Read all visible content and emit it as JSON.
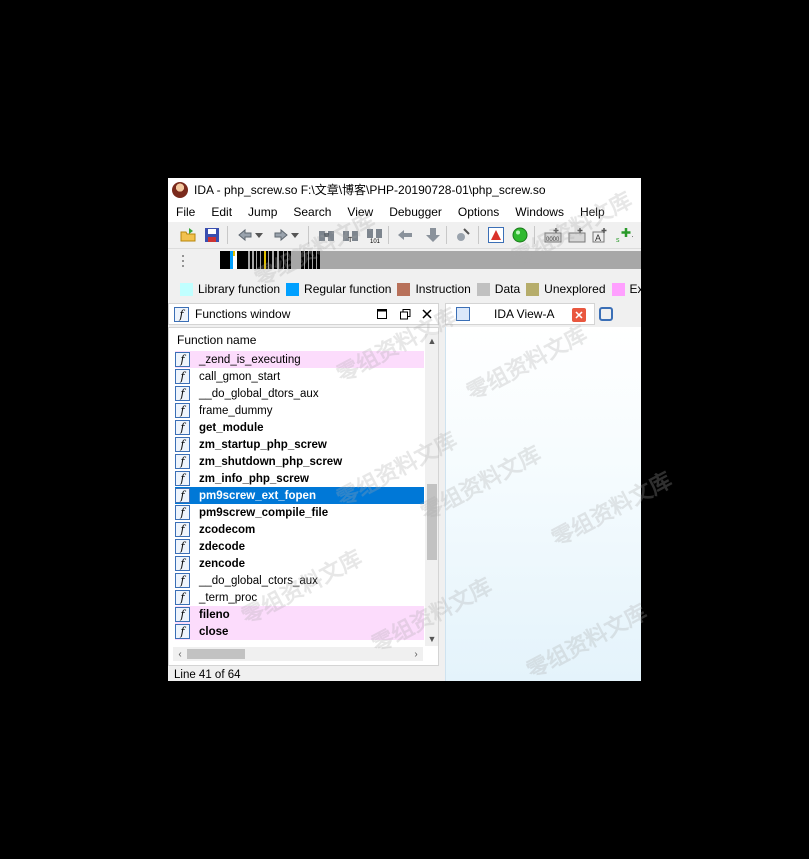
{
  "window": {
    "title": "IDA - php_screw.so F:\\文章\\博客\\PHP-20190728-01\\php_screw.so",
    "app_icon": "ida-icon"
  },
  "menu": [
    "File",
    "Edit",
    "Jump",
    "Search",
    "View",
    "Debugger",
    "Options",
    "Windows",
    "Help"
  ],
  "toolbar": {
    "icons": [
      "open-icon",
      "save-icon",
      "back-icon",
      "forward-icon",
      "binoculars-icon",
      "binoculars-text-icon",
      "binoculars-hex-icon",
      "jump-icon",
      "down-arrow-icon",
      "debug-icon",
      "warning-icon",
      "run-icon",
      "add-code-icon",
      "add-data-icon",
      "add-string-icon",
      "add-struct-icon"
    ]
  },
  "legend": [
    {
      "label": "Library function",
      "color": "#c0ffff"
    },
    {
      "label": "Regular function",
      "color": "#00a0ff"
    },
    {
      "label": "Instruction",
      "color": "#b8715a"
    },
    {
      "label": "Data",
      "color": "#c0c0c0"
    },
    {
      "label": "Unexplored",
      "color": "#b6ad6b"
    },
    {
      "label": "External symbol",
      "color": "#ffa0ff"
    }
  ],
  "functions_window": {
    "title": "Functions window",
    "column_header": "Function name",
    "rows": [
      {
        "name": "_zend_is_executing",
        "bold": false,
        "pink": true,
        "selected": false
      },
      {
        "name": "call_gmon_start",
        "bold": false,
        "pink": false,
        "selected": false
      },
      {
        "name": "__do_global_dtors_aux",
        "bold": false,
        "pink": false,
        "selected": false
      },
      {
        "name": "frame_dummy",
        "bold": false,
        "pink": false,
        "selected": false
      },
      {
        "name": "get_module",
        "bold": true,
        "pink": false,
        "selected": false
      },
      {
        "name": "zm_startup_php_screw",
        "bold": true,
        "pink": false,
        "selected": false
      },
      {
        "name": "zm_shutdown_php_screw",
        "bold": true,
        "pink": false,
        "selected": false
      },
      {
        "name": "zm_info_php_screw",
        "bold": true,
        "pink": false,
        "selected": false
      },
      {
        "name": "pm9screw_ext_fopen",
        "bold": true,
        "pink": false,
        "selected": true
      },
      {
        "name": "pm9screw_compile_file",
        "bold": true,
        "pink": false,
        "selected": false
      },
      {
        "name": "zcodecom",
        "bold": true,
        "pink": false,
        "selected": false
      },
      {
        "name": "zdecode",
        "bold": true,
        "pink": false,
        "selected": false
      },
      {
        "name": "zencode",
        "bold": true,
        "pink": false,
        "selected": false
      },
      {
        "name": "__do_global_ctors_aux",
        "bold": false,
        "pink": false,
        "selected": false
      },
      {
        "name": "_term_proc",
        "bold": false,
        "pink": false,
        "selected": false
      },
      {
        "name": "fileno",
        "bold": true,
        "pink": true,
        "selected": false
      },
      {
        "name": "close",
        "bold": true,
        "pink": true,
        "selected": false
      }
    ],
    "status": "Line 41 of 64"
  },
  "ida_view": {
    "tab_label": "IDA View-A"
  },
  "watermark": "零组资料文库"
}
